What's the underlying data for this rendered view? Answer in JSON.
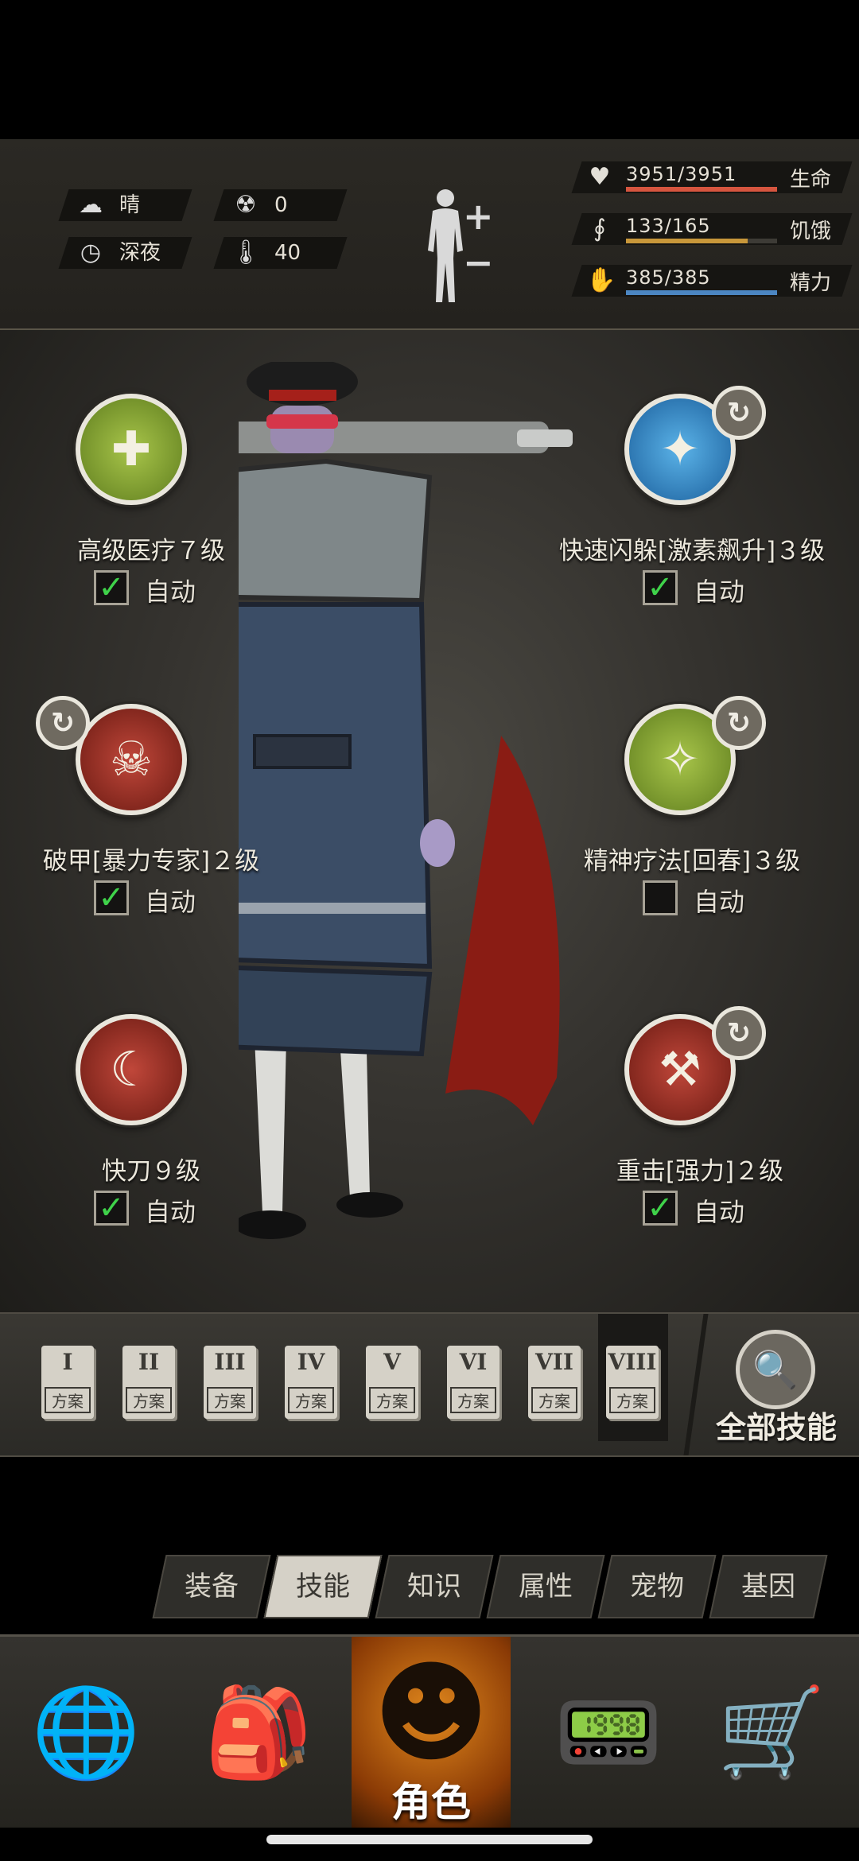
{
  "environment": {
    "weather": {
      "icon": "partly-cloudy-icon",
      "label": "晴"
    },
    "radiation": {
      "icon": "radiation-icon",
      "value": "0"
    },
    "time_of_day": {
      "icon": "clock-icon",
      "label": "深夜"
    },
    "temperature": {
      "icon": "thermometer-icon",
      "value": "40"
    }
  },
  "body_status": {
    "plus": "+",
    "minus": "−"
  },
  "stats": [
    {
      "icon": "heart-icon",
      "value": "3951/3951",
      "label": "生命",
      "fill": 1.0,
      "color": "#d6553f"
    },
    {
      "icon": "stomach-icon",
      "value": "133/165",
      "label": "饥饿",
      "fill": 0.806,
      "color": "#c8973a"
    },
    {
      "icon": "energy-icon",
      "value": "385/385",
      "label": "精力",
      "fill": 1.0,
      "color": "#4c86c2"
    }
  ],
  "skills": [
    {
      "name": "高级医疗７级",
      "auto_label": "自动",
      "auto_checked": true,
      "icon": "medkit-icon",
      "icon_color": "green",
      "swappable": false
    },
    {
      "name": "快速闪躲[激素飙升]３级",
      "auto_label": "自动",
      "auto_checked": true,
      "icon": "dodge-icon",
      "icon_color": "blue",
      "swappable": true
    },
    {
      "name": "破甲[暴力专家]２级",
      "auto_label": "自动",
      "auto_checked": true,
      "icon": "skull-dice-icon",
      "icon_color": "red",
      "swappable": true
    },
    {
      "name": "精神疗法[回春]３级",
      "auto_label": "自动",
      "auto_checked": false,
      "icon": "mental-heal-icon",
      "icon_color": "green",
      "swappable": true
    },
    {
      "name": "快刀９级",
      "auto_label": "自动",
      "auto_checked": true,
      "icon": "quick-blade-icon",
      "icon_color": "red",
      "swappable": false
    },
    {
      "name": "重击[强力]２级",
      "auto_label": "自动",
      "auto_checked": true,
      "icon": "heavy-strike-icon",
      "icon_color": "red",
      "swappable": true
    }
  ],
  "loadouts": {
    "label": "方案",
    "numbers": [
      "I",
      "II",
      "III",
      "IV",
      "V",
      "VI",
      "VII",
      "VIII"
    ],
    "selected": "VIII"
  },
  "all_skills": {
    "label": "全部技能",
    "icon": "skill-search-icon"
  },
  "sub_tabs": {
    "items": [
      "装备",
      "技能",
      "知识",
      "属性",
      "宠物",
      "基因"
    ],
    "active": "技能"
  },
  "bottom_nav": {
    "items": [
      {
        "icon": "globe-icon"
      },
      {
        "icon": "backpack-icon"
      },
      {
        "icon": "character-head-icon",
        "label": "角色",
        "active": true
      },
      {
        "icon": "walkie-talkie-icon"
      },
      {
        "icon": "shopping-cart-icon"
      }
    ]
  }
}
